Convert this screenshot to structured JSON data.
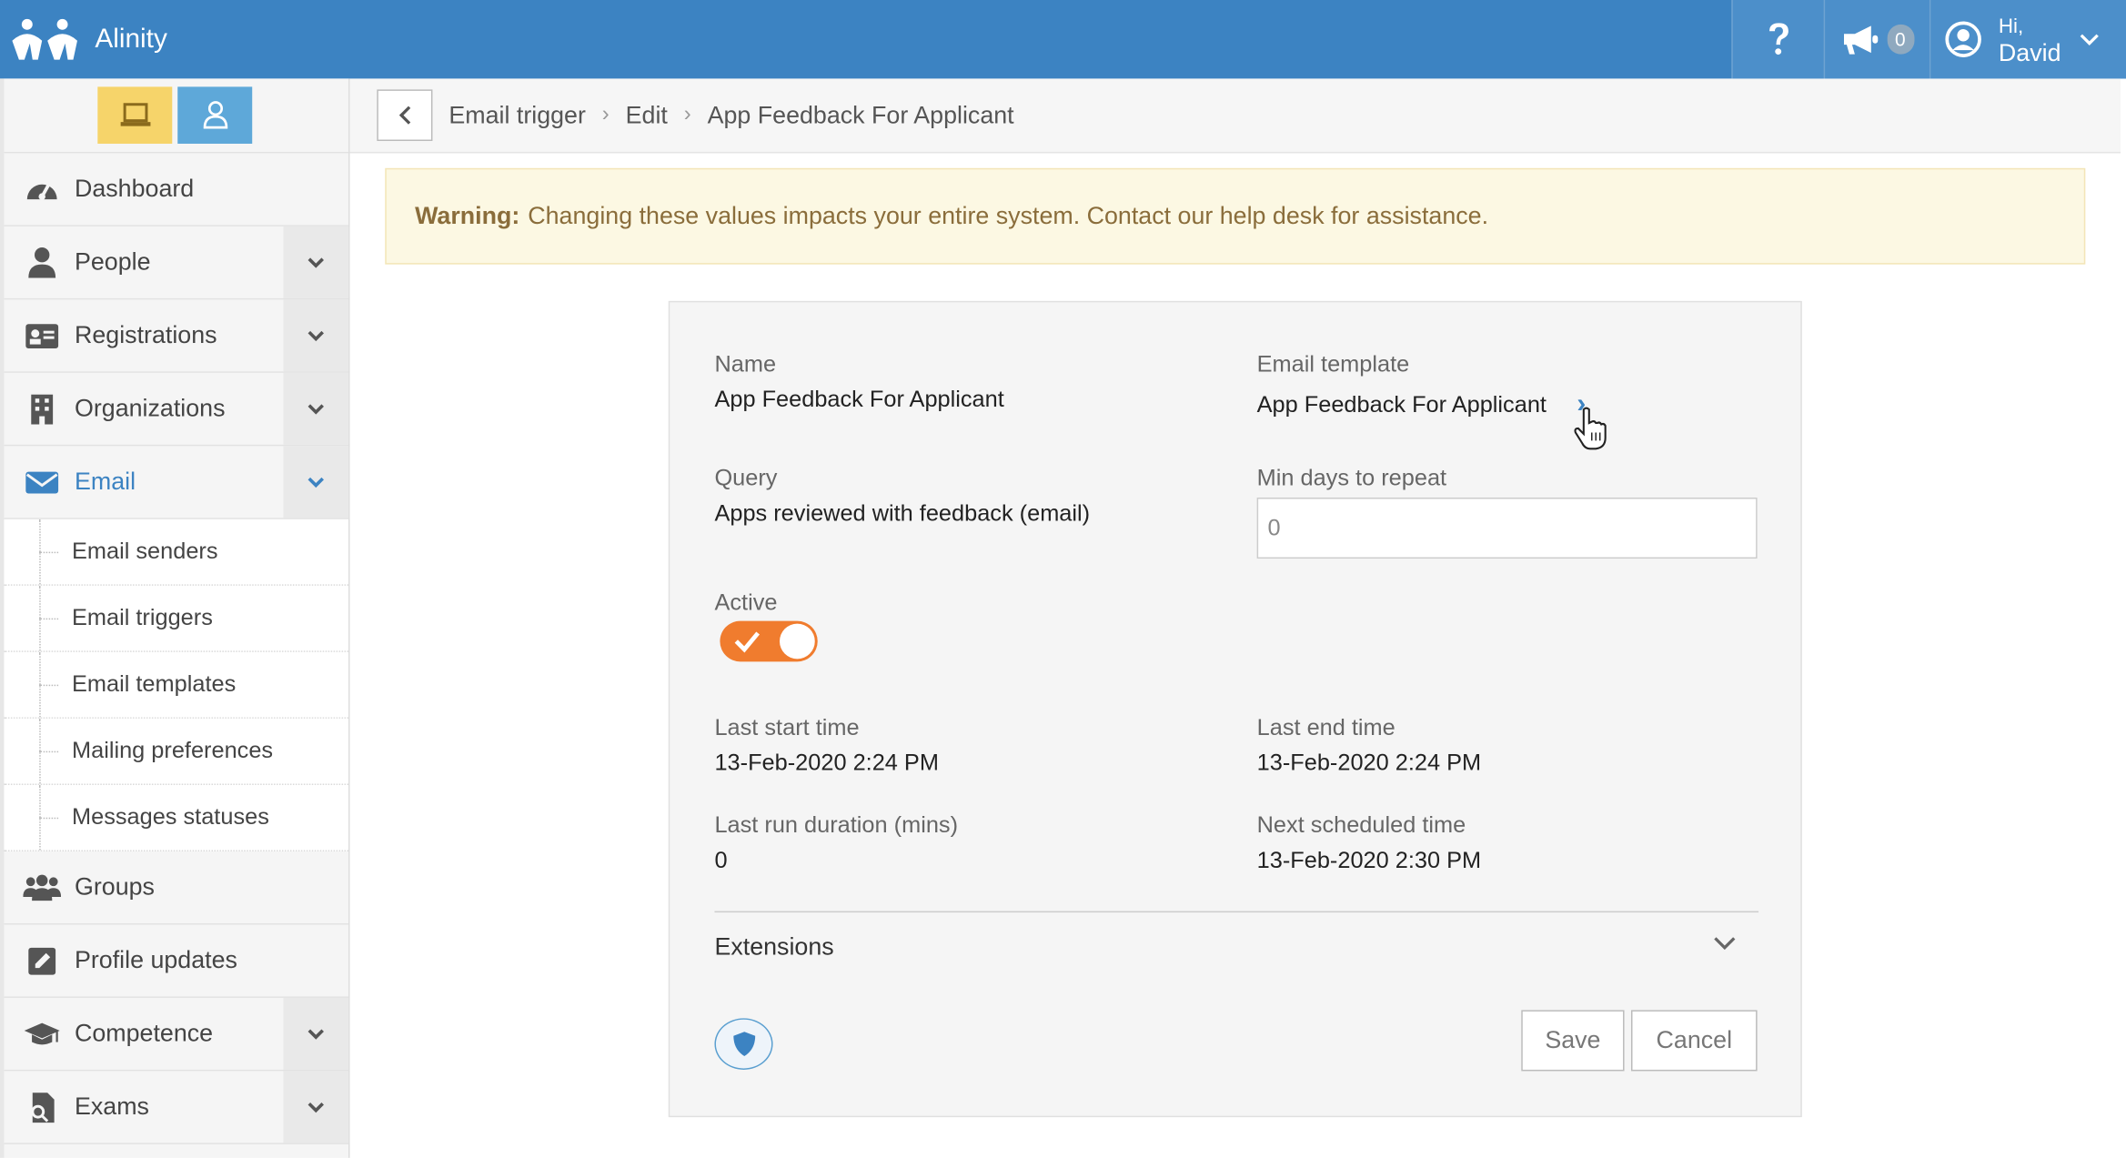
{
  "app": {
    "name": "Alinity"
  },
  "topbar": {
    "help_icon": "question-icon",
    "notifications": {
      "icon": "megaphone-icon",
      "count": "0"
    },
    "user": {
      "greeting": "Hi,",
      "name": "David"
    }
  },
  "sidebar": {
    "mode_buttons": [
      "desktop-icon",
      "user-icon"
    ],
    "items": [
      {
        "label": "Dashboard",
        "icon": "speedometer-icon",
        "expandable": false
      },
      {
        "label": "People",
        "icon": "person-icon",
        "expandable": true
      },
      {
        "label": "Registrations",
        "icon": "id-card-icon",
        "expandable": true
      },
      {
        "label": "Organizations",
        "icon": "building-icon",
        "expandable": true
      },
      {
        "label": "Email",
        "icon": "envelope-icon",
        "expandable": true,
        "active": true,
        "children": [
          "Email senders",
          "Email triggers",
          "Email templates",
          "Mailing preferences",
          "Messages statuses"
        ]
      },
      {
        "label": "Groups",
        "icon": "group-icon",
        "expandable": false
      },
      {
        "label": "Profile updates",
        "icon": "edit-icon",
        "expandable": false
      },
      {
        "label": "Competence",
        "icon": "graduation-cap-icon",
        "expandable": true
      },
      {
        "label": "Exams",
        "icon": "exam-icon",
        "expandable": true
      }
    ]
  },
  "breadcrumb": {
    "items": [
      "Email trigger",
      "Edit",
      "App Feedback For Applicant"
    ],
    "separator": "›"
  },
  "warning": {
    "prefix": "Warning:",
    "message": "Changing these values impacts your entire system. Contact our help desk for assistance."
  },
  "form": {
    "name": {
      "label": "Name",
      "value": "App Feedback For Applicant"
    },
    "email_template": {
      "label": "Email template",
      "value": "App Feedback For Applicant",
      "link_glyph": "›"
    },
    "query": {
      "label": "Query",
      "value": "Apps reviewed with feedback (email)"
    },
    "min_days": {
      "label": "Min days to repeat",
      "value": "0"
    },
    "active": {
      "label": "Active",
      "on": true
    },
    "last_start": {
      "label": "Last start time",
      "value": "13-Feb-2020 2:24 PM"
    },
    "last_end": {
      "label": "Last end time",
      "value": "13-Feb-2020 2:24 PM"
    },
    "last_run": {
      "label": "Last run duration (mins)",
      "value": "0"
    },
    "next_scheduled": {
      "label": "Next scheduled time",
      "value": "13-Feb-2020 2:30 PM"
    },
    "extensions": {
      "label": "Extensions"
    },
    "save_label": "Save",
    "cancel_label": "Cancel"
  },
  "colors": {
    "topbar": "#3c83c2",
    "accent": "#3c83c2",
    "toggle": "#f07c2e",
    "warning_bg": "#fcf8e3",
    "warning_text": "#8a6d3b",
    "mode_desktop": "#f6d46a",
    "mode_user": "#5ea8d9"
  }
}
